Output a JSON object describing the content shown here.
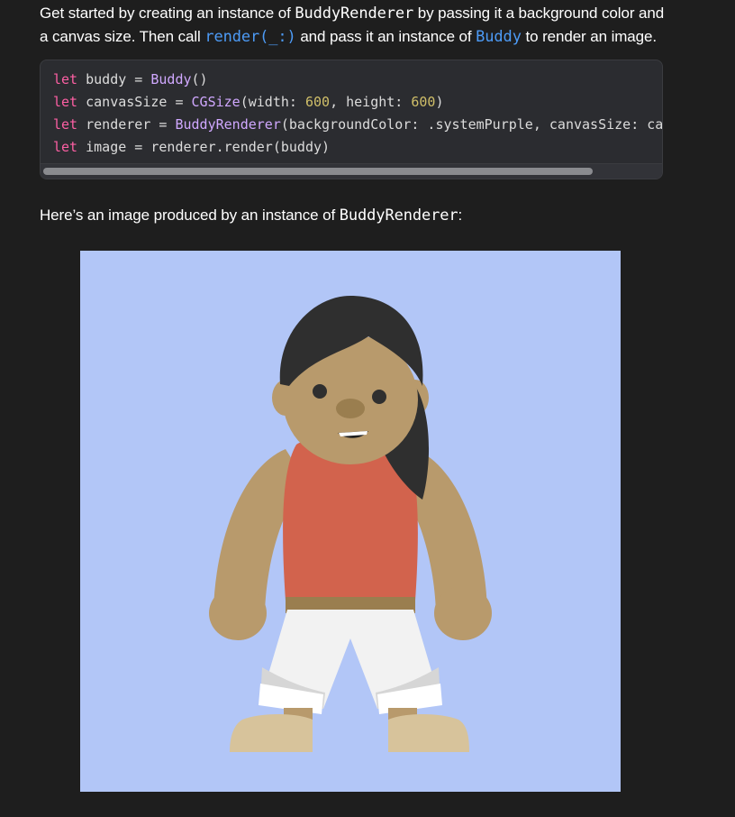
{
  "intro": {
    "t1": "Get started by creating an instance of ",
    "code1": "BuddyRenderer",
    "t2": " by passing it a background color and a canvas size. Then call ",
    "link1": "render(_:)",
    "t3": " and pass it an instance of ",
    "link2": "Buddy",
    "t4": " to render an image."
  },
  "code": {
    "line1": {
      "kw": "let",
      "rest1": " buddy = ",
      "type": "Buddy",
      "rest2": "()"
    },
    "line2": {
      "kw": "let",
      "rest1": " canvasSize = ",
      "type": "CGSize",
      "rest2": "(width: ",
      "n1": "600",
      "rest3": ", height: ",
      "n2": "600",
      "rest4": ")"
    },
    "line3": {
      "kw": "let",
      "rest1": " renderer = ",
      "type": "BuddyRenderer",
      "rest2": "(backgroundColor: .systemPurple, canvasSize: canvasSize)"
    },
    "line4": {
      "kw": "let",
      "rest1": " image = renderer.render(buddy)"
    }
  },
  "caption": {
    "t1": "Here’s an image produced by an instance of ",
    "code1": "BuddyRenderer",
    "t2": ":"
  },
  "figure": {
    "background_color": "#b2c6f7",
    "skin_color": "#b89a6c",
    "shirt_color": "#d2634d",
    "hair_color": "#2f2f2f",
    "shorts_color": "#f2f2f2",
    "shoe_color": "#d7c39b"
  }
}
